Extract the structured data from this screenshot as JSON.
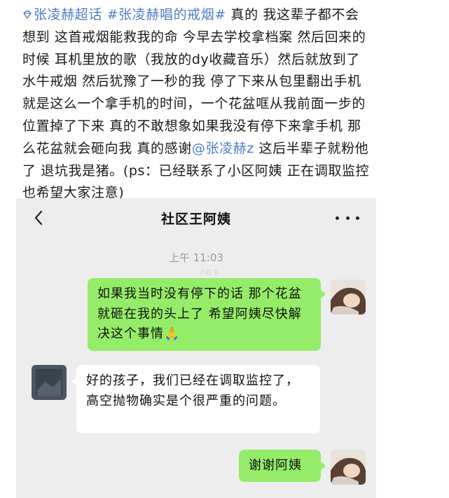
{
  "post": {
    "topic_super": "张凌赫超话",
    "topic_hashtag": "#张凌赫唱的戒烟#",
    "body_part1": " 真的 我这辈子都不会想到 这首戒烟能救我的命 今早去学校拿档案 然后回来的时候 耳机里放的歌（我放的dy收藏音乐）然后就放到了水牛戒烟 然后犹豫了一秒的我 停了下来从包里翻出手机 就是这么一个拿手机的时间，一个花盆哐从我前面一步的位置掉了下来 真的不敢想象如果我没有停下来拿手机 那么花盆就会砸向我 真的感谢",
    "mention": "@张凌赫z",
    "body_part2": " 这后半辈子就粉他了 退坑我是猪。(ps：已经联系了小区阿姨 正在调取监控 也希望大家注意)"
  },
  "chat": {
    "title": "社区王阿姨",
    "timestamp": "上午 11:03",
    "watermark": "小红书",
    "messages": [
      {
        "sender": "me",
        "text": "如果我当时没有停下的话 那个花盆就砸在我的头上了 希望阿姨尽快解决这个事情🙏"
      },
      {
        "sender": "aunt",
        "text": "好的孩子，我们已经在调取监控了，高空抛物确实是个很严重的问题。"
      },
      {
        "sender": "me",
        "text": "谢谢阿姨"
      }
    ]
  },
  "colors": {
    "link": "#4f7cc4",
    "bubble_me": "#95ec69",
    "bubble_them": "#ffffff",
    "chat_bg": "#ededed"
  },
  "icons": {
    "back": "chevron-left-icon",
    "more": "more-dots-icon",
    "topic": "diamond-topic-icon"
  }
}
